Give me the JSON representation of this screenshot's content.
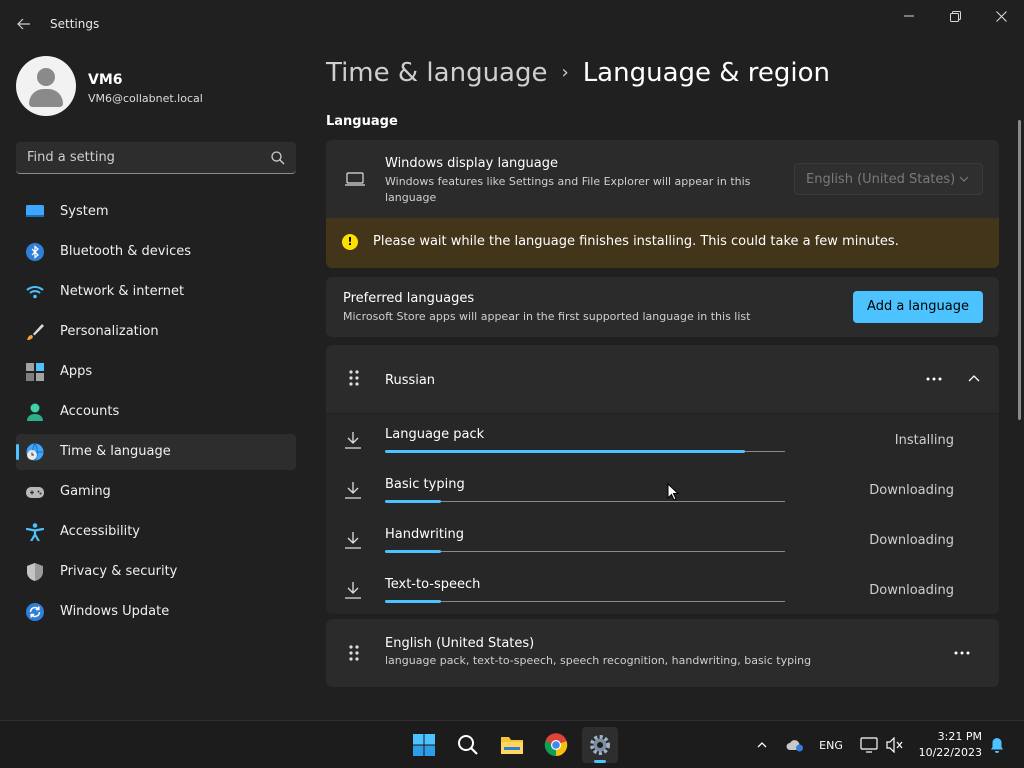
{
  "window": {
    "title": "Settings"
  },
  "profile": {
    "name": "VM6",
    "email": "VM6@collabnet.local"
  },
  "search": {
    "placeholder": "Find a setting"
  },
  "sidebar": {
    "items": [
      {
        "label": "System",
        "icon": "monitor-icon",
        "active": false
      },
      {
        "label": "Bluetooth & devices",
        "icon": "bluetooth-icon",
        "active": false
      },
      {
        "label": "Network & internet",
        "icon": "wifi-icon",
        "active": false
      },
      {
        "label": "Personalization",
        "icon": "brush-icon",
        "active": false
      },
      {
        "label": "Apps",
        "icon": "apps-icon",
        "active": false
      },
      {
        "label": "Accounts",
        "icon": "person-icon",
        "active": false
      },
      {
        "label": "Time & language",
        "icon": "globe-clock-icon",
        "active": true
      },
      {
        "label": "Gaming",
        "icon": "gamepad-icon",
        "active": false
      },
      {
        "label": "Accessibility",
        "icon": "accessibility-icon",
        "active": false
      },
      {
        "label": "Privacy & security",
        "icon": "shield-icon",
        "active": false
      },
      {
        "label": "Windows Update",
        "icon": "update-icon",
        "active": false
      }
    ]
  },
  "breadcrumb": {
    "parent": "Time & language",
    "separator": "›",
    "current": "Language & region"
  },
  "main": {
    "section_title": "Language",
    "display_language": {
      "title": "Windows display language",
      "subtitle": "Windows features like Settings and File Explorer will appear in this language",
      "selected": "English (United States)"
    },
    "warning": {
      "text": "Please wait while the language finishes installing. This could take a few minutes."
    },
    "preferred": {
      "title": "Preferred languages",
      "subtitle": "Microsoft Store apps will appear in the first supported language in this list",
      "add_button": "Add a language"
    },
    "russian": {
      "label": "Russian",
      "items": [
        {
          "label": "Language pack",
          "status": "Installing",
          "progress": 0.9
        },
        {
          "label": "Basic typing",
          "status": "Downloading",
          "progress": 0.14
        },
        {
          "label": "Handwriting",
          "status": "Downloading",
          "progress": 0.14
        },
        {
          "label": "Text-to-speech",
          "status": "Downloading",
          "progress": 0.14
        }
      ]
    },
    "english": {
      "title": "English (United States)",
      "subtitle": "language pack, text-to-speech, speech recognition, handwriting, basic typing"
    }
  },
  "taskbar": {
    "apps": [
      "start-icon",
      "search-icon",
      "file-explorer-icon",
      "chrome-icon",
      "settings-icon"
    ],
    "active_app": "settings-icon",
    "input_language": "ENG",
    "time": "3:21 PM",
    "date": "10/22/2023"
  },
  "colors": {
    "accent": "#4cc2ff",
    "background": "#202020",
    "card": "#2b2b2b",
    "warning_bg": "#433519",
    "warning_icon": "#fce100"
  }
}
